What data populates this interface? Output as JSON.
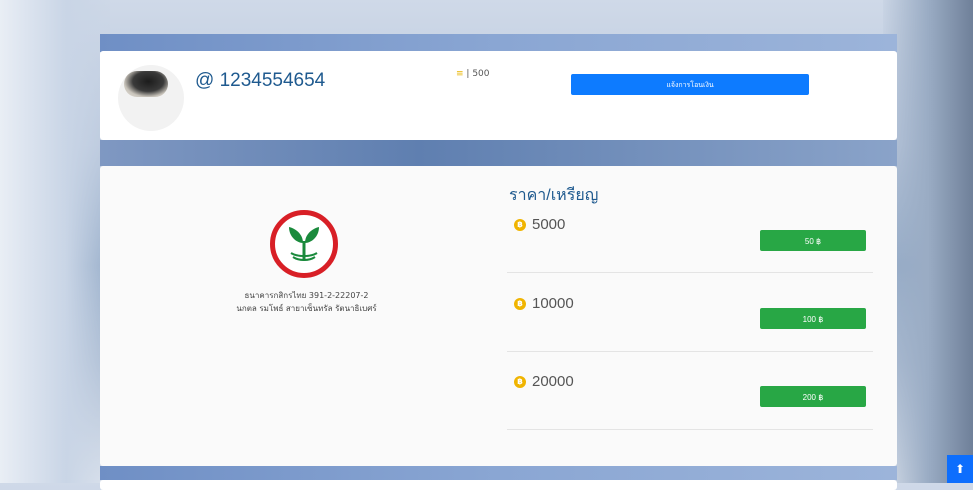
{
  "profile": {
    "username": "@ 1234554654",
    "coin_balance": "| 500",
    "notify_button": "แจ้งการโอนเงิน"
  },
  "bank": {
    "line1": "ธนาคารกสิกรไทย 391-2-22207-2",
    "line2": "นกตล รมโพธ์ สายาเซ็นทรัล รัตนาธิเบศร์"
  },
  "pricing": {
    "title": "ราคา/เหรียญ",
    "items": [
      {
        "coins": "5000",
        "price": "50 ฿"
      },
      {
        "coins": "10000",
        "price": "100 ฿"
      },
      {
        "coins": "20000",
        "price": "200 ฿"
      }
    ]
  },
  "colors": {
    "accent": "#0d7bff",
    "buy": "#28a745",
    "title": "#1f5a8f",
    "coin": "#f0b400",
    "bank_red": "#d81f26",
    "bank_green": "#1a8a3c"
  }
}
